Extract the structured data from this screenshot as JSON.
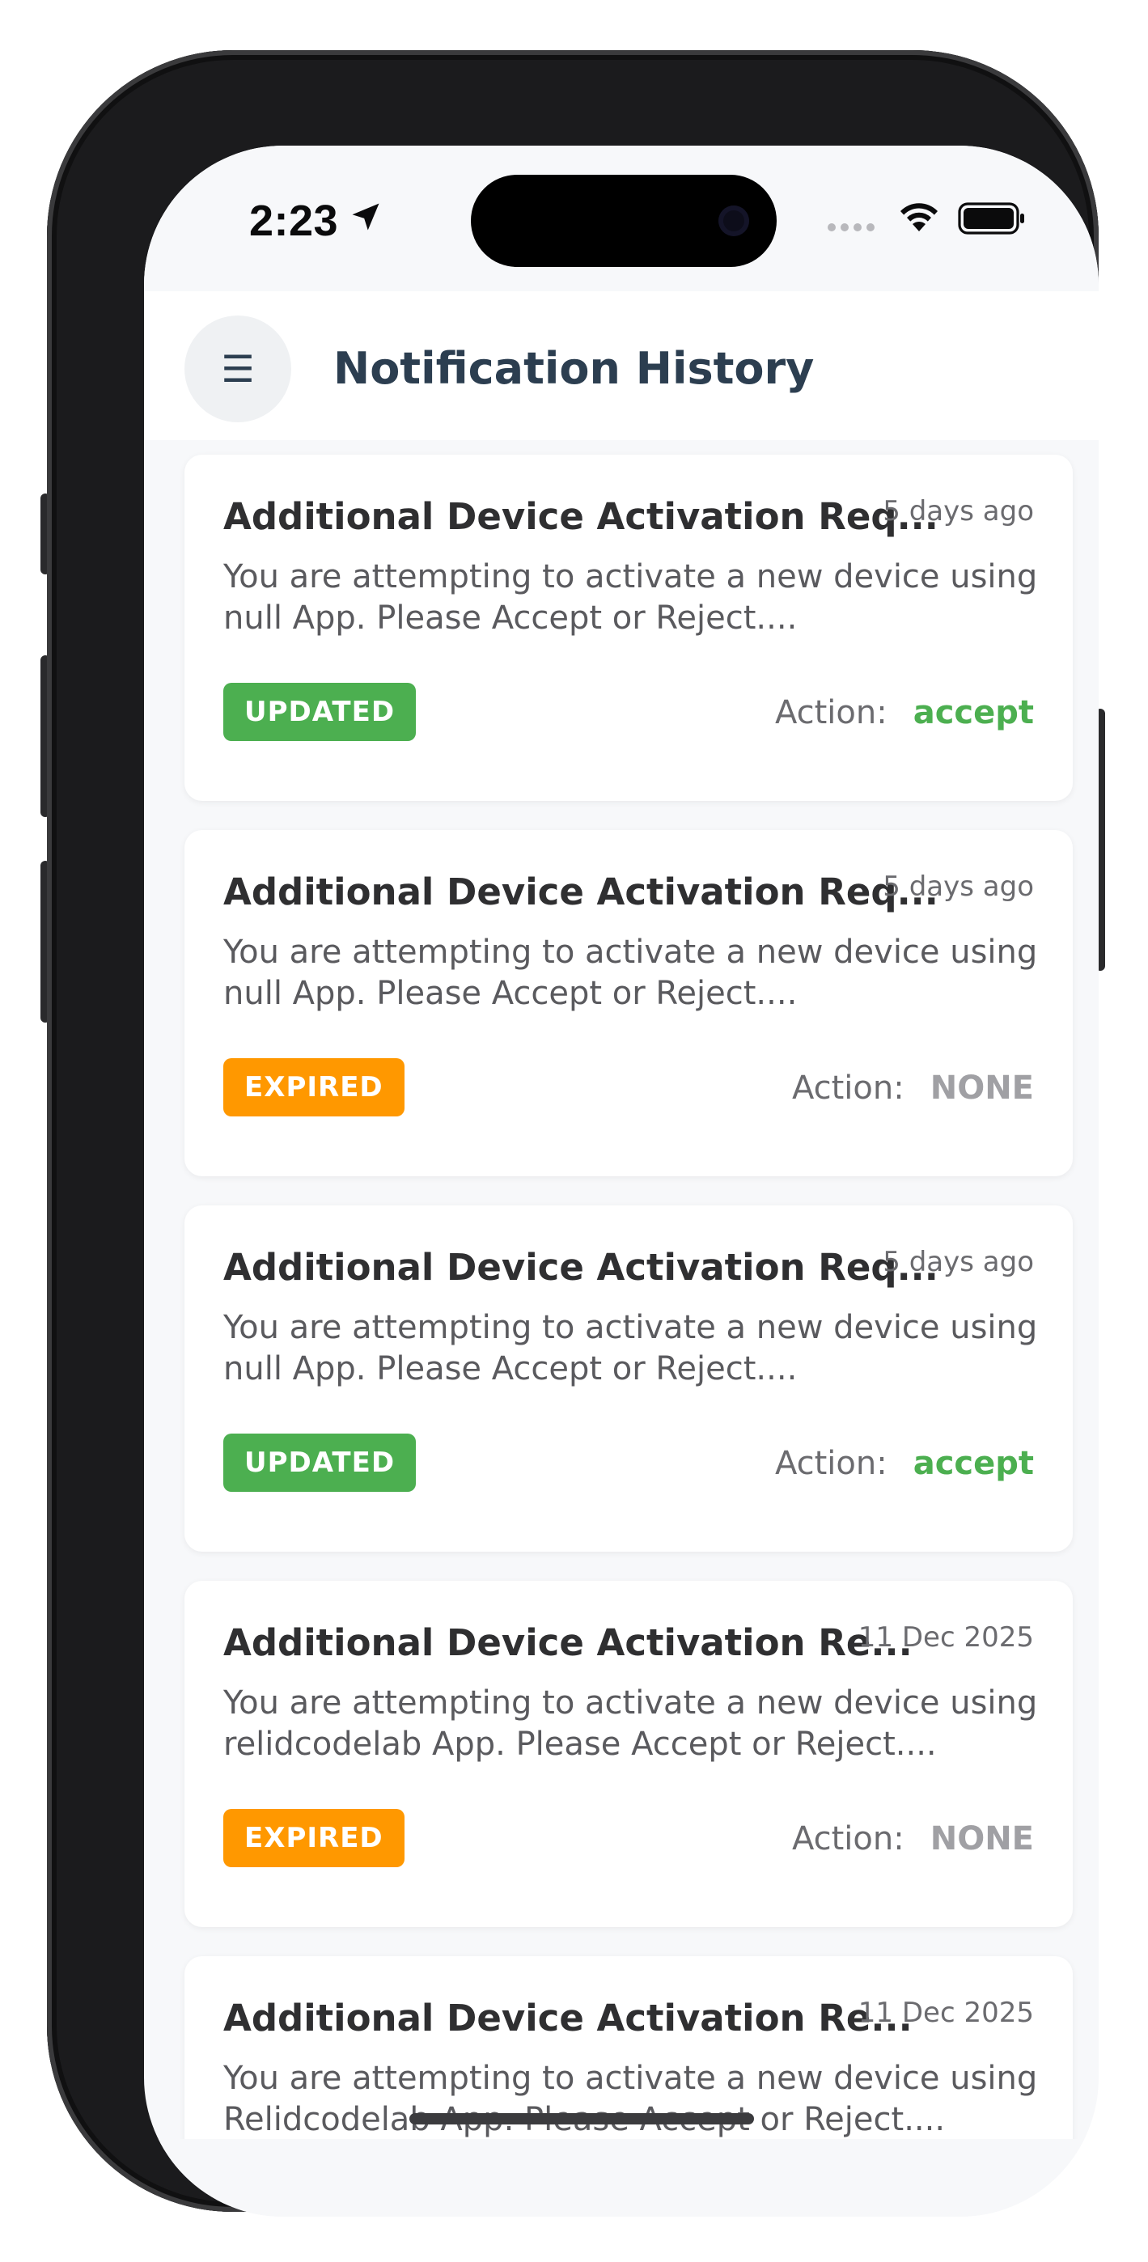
{
  "status_bar": {
    "time": "2:23",
    "location_icon": "location-arrow-icon",
    "signal_icon": "signal-dots-icon",
    "wifi_icon": "wifi-icon",
    "battery_icon": "battery-full-icon"
  },
  "header": {
    "menu_glyph": "☰",
    "menu_icon": "hamburger-menu-icon",
    "title": "Notification History"
  },
  "notifications": [
    {
      "title": "Additional Device Activation Req...",
      "time": "5 days ago",
      "message": "You are attempting to activate a new device using null App. Please Accept or Reject....",
      "status": "UPDATED",
      "action_label": "Action:",
      "action_value": "accept"
    },
    {
      "title": "Additional Device Activation Req...",
      "time": "5 days ago",
      "message": "You are attempting to activate a new device using null App. Please Accept or Reject....",
      "status": "EXPIRED",
      "action_label": "Action:",
      "action_value": "NONE"
    },
    {
      "title": "Additional Device Activation Req...",
      "time": "5 days ago",
      "message": "You are attempting to activate a new device using null App. Please Accept or Reject....",
      "status": "UPDATED",
      "action_label": "Action:",
      "action_value": "accept"
    },
    {
      "title": "Additional Device Activation Re...",
      "time": "11 Dec 2025",
      "message": "You are attempting to activate a new device using relidcodelab App. Please Accept or Reject....",
      "status": "EXPIRED",
      "action_label": "Action:",
      "action_value": "NONE"
    },
    {
      "title": "Additional Device Activation Re...",
      "time": "11 Dec 2025",
      "message": "You are attempting to activate a new device using Relidcodelab App. Please Accept or Reject...."
    }
  ],
  "colors": {
    "updated": "#4caf50",
    "expired": "#ff9800",
    "accept": "#4caf50",
    "none": "#a0a0a4",
    "title": "#2c3e50"
  }
}
